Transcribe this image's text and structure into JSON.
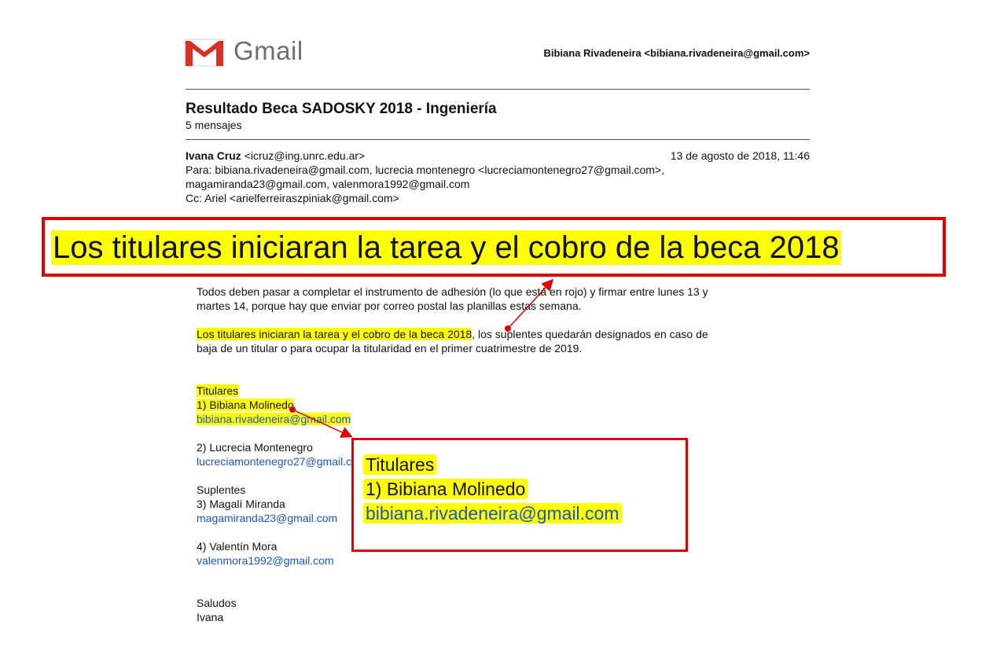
{
  "header": {
    "logo_text": "Gmail",
    "account": "Bibiana Rivadeneira <bibiana.rivadeneira@gmail.com>"
  },
  "thread": {
    "subject": "Resultado Beca SADOSKY 2018 - Ingeniería",
    "count": "5 mensajes"
  },
  "message": {
    "sender_name": "Ivana Cruz",
    "sender_email": " <icruz@ing.unrc.edu.ar>",
    "date": "13 de agosto de 2018, 11:46",
    "to_line1": "Para: bibiana.rivadeneira@gmail.com, lucrecia montenegro <lucreciamontenegro27@gmail.com>,",
    "to_line2": "magamiranda23@gmail.com, valenmora1992@gmail.com",
    "cc": "Cc: Ariel <arielferreiraszpiniak@gmail.com>",
    "para1_l1": "Todos deben pasar a completar el instrumento de adhesión (lo que está en rojo) y firmar entre lunes 13 y",
    "para1_l2": "martes 14, porque hay que enviar por correo postal las planillas estas semana.",
    "para2_hl": "Los titulares iniciaran la tarea y el cobro de la beca 2018",
    "para2_rest": ", los suplentes quedarán designados en caso de",
    "para2_l2": "baja de un titular o para ocupar la titularidad en el primer cuatrimestre de 2019.",
    "titulares": "Titulares",
    "t1_name": "1) Bibiana Molinedo",
    "t1_email": "bibiana.rivadeneira@gmail.com",
    "t2_name": "2) Lucrecia Montenegro",
    "t2_email": "lucreciamontenegro27@gmail.com",
    "suplentes": "Suplentes",
    "s3_name": "3) Magalí Miranda",
    "s3_email": "magamiranda23@gmail.com",
    "s4_name": "4) Valentín Mora",
    "s4_email": "valenmora1992@gmail.com",
    "closing": "Saludos",
    "signature": "Ivana"
  },
  "callouts": {
    "banner": "Los titulares iniciaran la tarea y el cobro de la beca 2018",
    "zoom_l1": "Titulares",
    "zoom_l2": "1) Bibiana Molinedo",
    "zoom_l3": "bibiana.rivadeneira@gmail.com"
  },
  "colors": {
    "highlight": "#ffff00",
    "callout_border": "#e10000",
    "link": "#1a55c7"
  }
}
